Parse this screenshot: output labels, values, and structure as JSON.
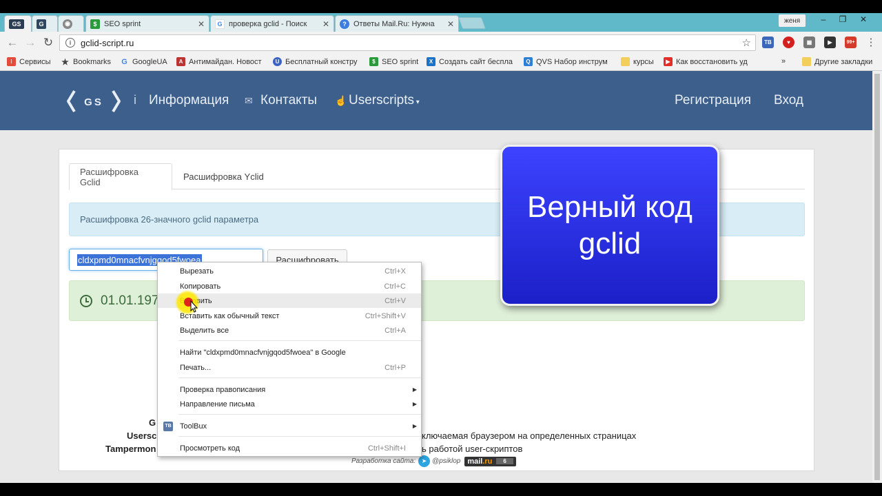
{
  "browser": {
    "tabs": [
      {
        "label": "",
        "favicon": "gs-logo"
      },
      {
        "label": "",
        "favicon": "gs-square"
      },
      {
        "label": "",
        "favicon": "eye-icon"
      },
      {
        "label": "SEO sprint",
        "favicon": "seo-sprint-icon"
      },
      {
        "label": "проверка gclid - Поиск",
        "favicon": "google-g-icon"
      },
      {
        "label": "Ответы Mail.Ru: Нужна",
        "favicon": "question-icon"
      }
    ],
    "user_name": "женя",
    "url": "gclid-script.ru",
    "bookmarks": [
      "Сервисы",
      "Bookmarks",
      "GoogleUA",
      "Антимайдан. Новост",
      "Бесплатный констру",
      "SEO sprint",
      "Создать сайт беспла",
      "QVS Набор инструм",
      "курсы",
      "Как восстановить уд"
    ],
    "more_bookmarks": "»",
    "other_bookmarks": "Другие закладки",
    "ext_badge": "99+"
  },
  "site": {
    "logo_text": "GS",
    "nav": {
      "info_icon": "i",
      "info": "Информация",
      "contacts": "Контакты",
      "userscripts": "Userscripts",
      "register": "Регистрация",
      "login": "Вход"
    },
    "tabs": [
      "Расшифровка Gclid",
      "Расшифровка Yclid"
    ],
    "alert_text": "Расшифровка 26-значного gclid параметра",
    "gclid_value": "cldxpmd0mnacfvnjgqod5fwoea",
    "decode_button": "Расшифровать",
    "result_date": "01.01.197",
    "faq": [
      {
        "label": "G",
        "text": ""
      },
      {
        "label": "Usersc",
        "text": "ключаемая браузером на определенных страницах"
      },
      {
        "label": "Tampermon",
        "text": "ь работой user-скриптов"
      }
    ],
    "credit_text": "Разработка сайта:",
    "credit_handle": "@psiklop",
    "mail_badge": {
      "brand": "mail",
      "tld": ".ru",
      "count": "6"
    }
  },
  "context_menu": {
    "items": [
      {
        "label": "Вырезать",
        "shortcut": "Ctrl+X"
      },
      {
        "label": "Копировать",
        "shortcut": "Ctrl+C"
      },
      {
        "label": "Вставить",
        "shortcut": "Ctrl+V"
      },
      {
        "label": "Вставить как обычный текст",
        "shortcut": "Ctrl+Shift+V"
      },
      {
        "label": "Выделить все",
        "shortcut": "Ctrl+A"
      },
      {
        "label": "Найти \"cldxpmd0mnacfvnjgqod5fwoea\" в Google",
        "shortcut": ""
      },
      {
        "label": "Печать...",
        "shortcut": "Ctrl+P"
      },
      {
        "label": "Проверка правописания",
        "shortcut": ""
      },
      {
        "label": "Направление письма",
        "shortcut": ""
      },
      {
        "label": "ToolBux",
        "shortcut": ""
      },
      {
        "label": "Просмотреть код",
        "shortcut": "Ctrl+Shift+I"
      }
    ],
    "highlighted": "Вставить"
  },
  "overlay": {
    "text": "Верный код gclid"
  },
  "colors": {
    "site_nav_bg": "#3d5f8c",
    "overlay_bg": "#2a30e8",
    "tabstrip": "#5fb9c9",
    "info_alert": "#d9edf7",
    "success_alert": "#dff0d8"
  }
}
